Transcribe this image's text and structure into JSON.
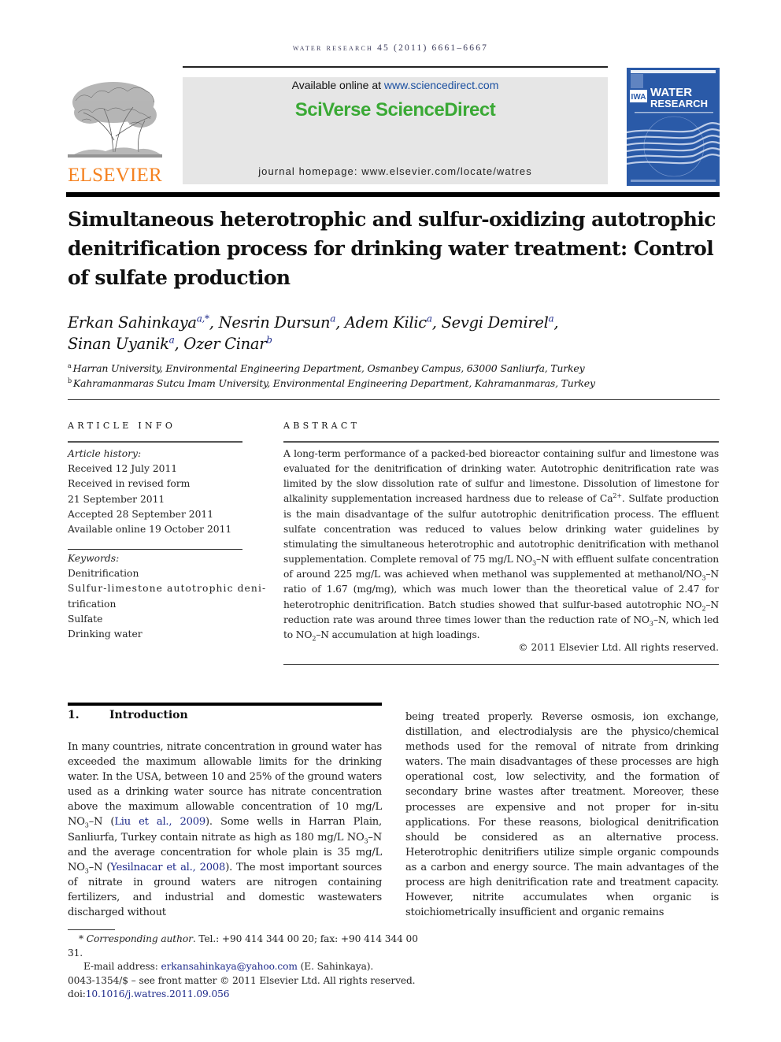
{
  "header": {
    "running_head": "WATER RESEARCH 45 (2011) 6661–6667",
    "publisher_logo": "ELSEVIER",
    "available_prefix": "Available online at ",
    "available_link": "www.sciencedirect.com",
    "platform_brand": "SciVerse ScienceDirect",
    "homepage_label": "journal homepage: ",
    "homepage_url": "www.elsevier.com/locate/watres",
    "cover": {
      "publisher_mark": "IWA",
      "title_line1": "WATER",
      "title_line2": "RESEARCH"
    },
    "colors": {
      "elsevier_orange": "#f58220",
      "sciverse_green": "#3aa935",
      "link_blue": "#1a4fa0",
      "cover_blue": "#2a5aa8"
    }
  },
  "article": {
    "title": "Simultaneous heterotrophic and sulfur-oxidizing autotrophic denitrification process for drinking water treatment: Control of sulfate production",
    "authors": [
      {
        "name": "Erkan Sahinkaya",
        "marks": "a,*"
      },
      {
        "name": "Nesrin Dursun",
        "marks": "a"
      },
      {
        "name": "Adem Kilic",
        "marks": "a"
      },
      {
        "name": "Sevgi Demirel",
        "marks": "a"
      },
      {
        "name": "Sinan Uyanik",
        "marks": "a"
      },
      {
        "name": "Ozer Cinar",
        "marks": "b"
      }
    ],
    "affiliations": [
      {
        "mark": "a",
        "text": "Harran University, Environmental Engineering Department, Osmanbey Campus, 63000 Sanliurfa, Turkey"
      },
      {
        "mark": "b",
        "text": "Kahramanmaras Sutcu Imam University, Environmental Engineering Department, Kahramanmaras, Turkey"
      }
    ]
  },
  "article_info": {
    "heading": "ARTICLE INFO",
    "history_label": "Article history:",
    "history": [
      "Received 12 July 2011",
      "Received in revised form",
      "21 September 2011",
      "Accepted 28 September 2011",
      "Available online 19 October 2011"
    ],
    "keywords_label": "Keywords:",
    "keywords": [
      "Denitrification",
      "Sulfur-limestone autotrophic deni-",
      "trification",
      "Sulfate",
      "Drinking water"
    ]
  },
  "abstract": {
    "heading": "ABSTRACT",
    "segments": {
      "s1": "A long-term performance of a packed-bed bioreactor containing sulfur and limestone was evaluated for the denitrification of drinking water. Autotrophic denitrification rate was limited by the slow dissolution rate of sulfur and limestone. Dissolution of limestone for alkalinity supplementation increased hardness due to release of Ca",
      "s1_sup": "2+",
      "s2": ". Sulfate production is the main disadvantage of the sulfur autotrophic denitrification process. The effluent sulfate concentration was reduced to values below drinking water guidelines by stimulating the simultaneous heterotrophic and autotrophic denitrification with methanol supplementation. Complete removal of 75 mg/L NO",
      "sub3": "3",
      "s3": "–N with effluent sulfate concentration of around 225 mg/L was achieved when methanol was supplemented at methanol/NO",
      "s4": "–N ratio of 1.67 (mg/mg), which was much lower than the theoretical value of 2.47 for heterotrophic denitrification. Batch studies showed that sulfur-based autotrophic NO",
      "sub2": "2",
      "s5": "–N reduction rate was around three times lower than the reduction rate of NO",
      "s6": "–N, which led to NO",
      "s7": "–N accumulation at high loadings."
    },
    "copyright": "© 2011 Elsevier Ltd. All rights reserved."
  },
  "introduction": {
    "number": "1.",
    "heading": "Introduction",
    "left": {
      "p1": "In many countries, nitrate concentration in ground water has exceeded the maximum allowable limits for the drinking water. In the USA, between 10 and 25% of the ground waters used as a drinking water source has nitrate concentration above the maximum allowable concentration of 10 mg/L NO",
      "sub3": "3",
      "p2": "–N (",
      "ref1": "Liu et al., 2009",
      "p3": "). Some wells in Harran Plain, Sanliurfa, Turkey contain nitrate as high as 180 mg/L NO",
      "p4": "–N and the average concentration for whole plain is 35 mg/L NO",
      "p5": "–N (",
      "ref2": "Yesilnacar et al., 2008",
      "p6": "). The most important sources of nitrate in ground waters are nitrogen containing fertilizers, and industrial and domestic wastewaters discharged without"
    },
    "right": "being treated properly. Reverse osmosis, ion exchange, distillation, and electrodialysis are the physico/chemical methods used for the removal of nitrate from drinking waters. The main disadvantages of these processes are high operational cost, low selectivity, and the formation of secondary brine wastes after treatment. Moreover, these processes are expensive and not proper for in-situ applications. For these reasons, biological denitrification should be considered as an alternative process. Heterotrophic denitrifiers utilize simple organic compounds as a carbon and energy source. The main advantages of the process are high denitrification rate and treatment capacity. However, nitrite accumulates when organic is stoichiometrically insufficient and organic remains"
  },
  "footnotes": {
    "star": "*",
    "corr_label": "Corresponding author",
    "corr_text": ". Tel.: +90 414 344 00 20; fax: +90 414 344 00 31.",
    "email_label": "E-mail address: ",
    "email": "erkansahinkaya@yahoo.com",
    "email_suffix": " (E. Sahinkaya).",
    "front_matter": "0043-1354/$ – see front matter © 2011 Elsevier Ltd. All rights reserved.",
    "doi_label": "doi:",
    "doi": "10.1016/j.watres.2011.09.056"
  }
}
